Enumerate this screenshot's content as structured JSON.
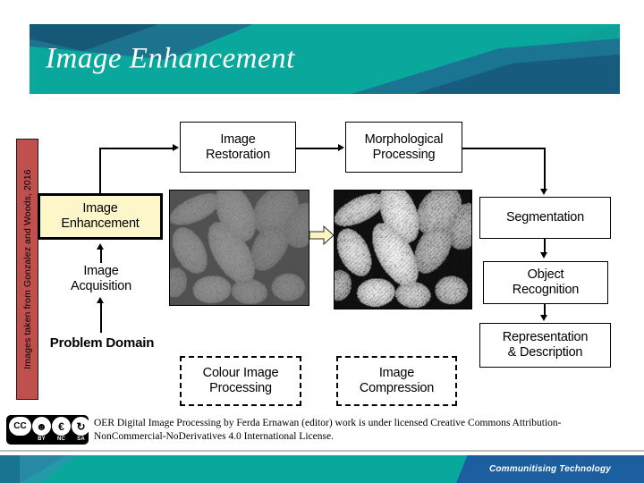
{
  "slide": {
    "title": "Image Enhancement",
    "credit_sidebar": "Images taken from Gonzalez and Woods, 2016"
  },
  "diagram": {
    "nodes": [
      {
        "id": "image-restoration",
        "label_line1": "Image",
        "label_line2": "Restoration",
        "style": "boxed"
      },
      {
        "id": "morphological",
        "label_line1": "Morphological",
        "label_line2": "Processing",
        "style": "boxed"
      },
      {
        "id": "image-enhancement",
        "label_line1": "Image",
        "label_line2": "Enhancement",
        "style": "highlight"
      },
      {
        "id": "image-acquisition",
        "label_line1": "Image",
        "label_line2": "Acquisition",
        "style": "plain"
      },
      {
        "id": "problem-domain",
        "label_line1": "Problem Domain",
        "label_line2": "",
        "style": "plain"
      },
      {
        "id": "segmentation",
        "label_line1": "Segmentation",
        "label_line2": "",
        "style": "boxed"
      },
      {
        "id": "object-recognition",
        "label_line1": "Object",
        "label_line2": "Recognition",
        "style": "boxed"
      },
      {
        "id": "representation",
        "label_line1": "Representation",
        "label_line2": "& Description",
        "style": "boxed"
      },
      {
        "id": "colour-image",
        "label_line1": "Colour Image",
        "label_line2": "Processing",
        "style": "dashed"
      },
      {
        "id": "image-compression",
        "label_line1": "Image",
        "label_line2": "Compression",
        "style": "dashed"
      }
    ],
    "images": {
      "original_caption": "original low-contrast pollen image",
      "enhanced_caption": "contrast-enhanced pollen image",
      "arrow_color": "#fcf6c0"
    }
  },
  "footer": {
    "license_text": "OER Digital Image Processing by Ferda Ernawan (editor) work is under licensed Creative Commons Attribution-NonCommercial-NoDerivatives 4.0 International License.",
    "cc_marks": [
      "BY",
      "NC",
      "SA"
    ],
    "cc_symbol": "CC",
    "cc_by_glyph": "i",
    "cc_nc_glyph": "$",
    "cc_nd_glyph": "=",
    "tagline": "Communitising Technology"
  },
  "colors": {
    "banner_teal": "#0aa89c",
    "banner_blue": "#1f6a8c",
    "credit_red": "#c0504d",
    "highlight_yellow": "#fdf6c8",
    "footer_blue": "#1c5fa0"
  }
}
